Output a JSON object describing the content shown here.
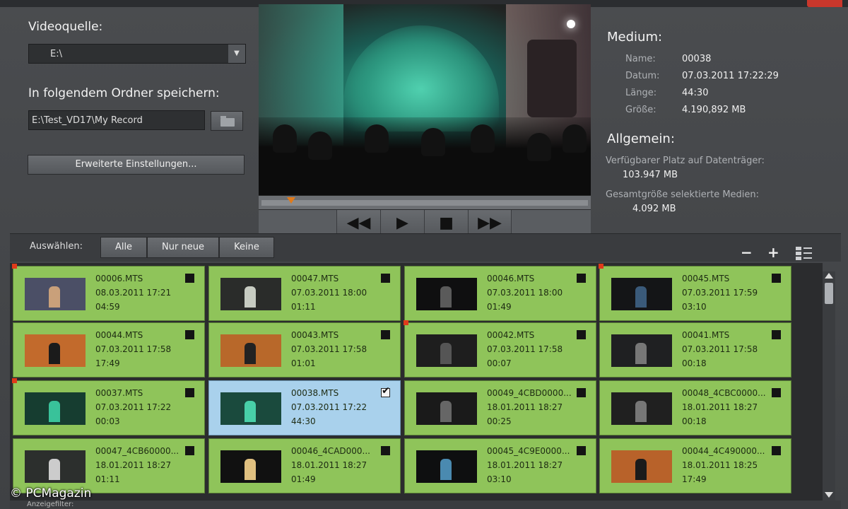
{
  "left": {
    "source_label": "Videoquelle:",
    "source_value": "E:\\",
    "folder_label": "In folgendem Ordner speichern:",
    "folder_value": "E:\\Test_VD17\\My Record",
    "advanced_button": "Erweiterte Einstellungen..."
  },
  "transport": {
    "rewind": "◀◀",
    "play": "▶",
    "stop": "■",
    "forward": "▶▶"
  },
  "medium": {
    "title": "Medium:",
    "name_label": "Name:",
    "name_value": "00038",
    "date_label": "Datum:",
    "date_value": "07.03.2011 17:22:29",
    "length_label": "Länge:",
    "length_value": "44:30",
    "size_label": "Größe:",
    "size_value": "4.190,892 MB"
  },
  "general": {
    "title": "Allgemein:",
    "free_label": "Verfügbarer Platz auf Datenträger:",
    "free_value": "103.947 MB",
    "total_label": "Gesamtgröße selektierte Medien:",
    "total_value": "4.092 MB"
  },
  "selection": {
    "label": "Auswählen:",
    "all": "Alle",
    "only_new": "Nur neue",
    "none": "Keine",
    "minus": "−",
    "plus": "+"
  },
  "tiles": [
    {
      "name": "00006.MTS",
      "date": "08.03.2011 17:21",
      "len": "04:59"
    },
    {
      "name": "00047.MTS",
      "date": "07.03.2011 18:00",
      "len": "01:11"
    },
    {
      "name": "00046.MTS",
      "date": "07.03.2011 18:00",
      "len": "01:49"
    },
    {
      "name": "00045.MTS",
      "date": "07.03.2011 17:59",
      "len": "03:10"
    },
    {
      "name": "00044.MTS",
      "date": "07.03.2011 17:58",
      "len": "17:49"
    },
    {
      "name": "00043.MTS",
      "date": "07.03.2011 17:58",
      "len": "01:01"
    },
    {
      "name": "00042.MTS",
      "date": "07.03.2011 17:58",
      "len": "00:07"
    },
    {
      "name": "00041.MTS",
      "date": "07.03.2011 17:58",
      "len": "00:18"
    },
    {
      "name": "00037.MTS",
      "date": "07.03.2011 17:22",
      "len": "00:03"
    },
    {
      "name": "00038.MTS",
      "date": "07.03.2011 17:22",
      "len": "44:30"
    },
    {
      "name": "00049_4CBD0000...",
      "date": "18.01.2011 18:27",
      "len": "00:25"
    },
    {
      "name": "00048_4CBC0000...",
      "date": "18.01.2011 18:27",
      "len": "00:18"
    },
    {
      "name": "00047_4CB60000...",
      "date": "18.01.2011 18:27",
      "len": "01:11"
    },
    {
      "name": "00046_4CAD000...",
      "date": "18.01.2011 18:27",
      "len": "01:49"
    },
    {
      "name": "00045_4C9E0000...",
      "date": "18.01.2011 18:27",
      "len": "03:10"
    },
    {
      "name": "00044_4C490000...",
      "date": "18.01.2011 18:25",
      "len": "17:49"
    }
  ],
  "filter": {
    "label": "Anzeigefilter:"
  },
  "watermark": "© PCMagazin",
  "colors": {
    "tile_green": "#8fc45a",
    "tile_selected": "#a9d1ec",
    "new_marker": "#e03a1a",
    "playhead": "#e07a1a"
  }
}
